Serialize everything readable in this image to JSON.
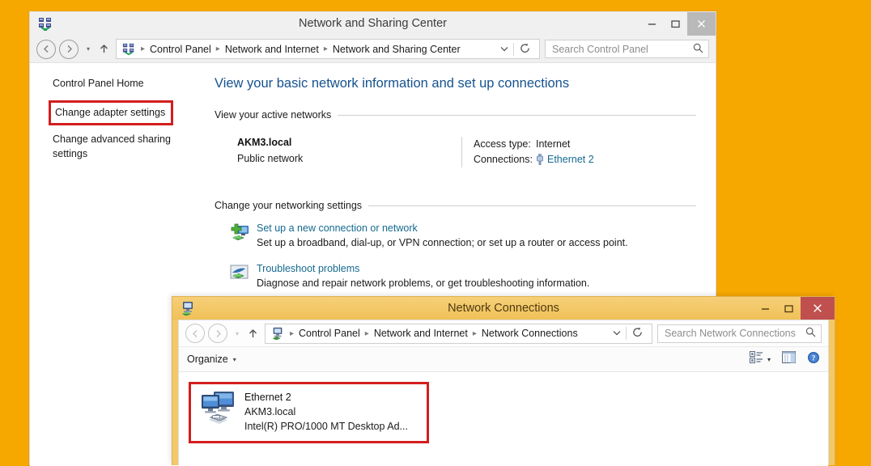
{
  "desktop": {
    "background_color": "#F7A800"
  },
  "window1": {
    "title": "Network and Sharing Center",
    "icon": "network-sharing-icon",
    "buttons": {
      "minimize": "–",
      "maximize": "□",
      "close": "✕"
    },
    "nav": {
      "back": "←",
      "forward": "→",
      "recent": "▾",
      "up": "↑",
      "breadcrumb": [
        "Control Panel",
        "Network and Internet",
        "Network and Sharing Center"
      ],
      "breadcrumb_chevron": "⌄",
      "refresh": "↻",
      "search_placeholder": "Search Control Panel",
      "search_value": ""
    },
    "sidebar": {
      "items": [
        {
          "label": "Control Panel Home",
          "highlighted": false
        },
        {
          "label": "Change adapter settings",
          "highlighted": true
        },
        {
          "label": "Change advanced sharing settings",
          "highlighted": false
        }
      ]
    },
    "main": {
      "heading": "View your basic network information and set up connections",
      "active_networks_header": "View your active networks",
      "active_network": {
        "name": "AKM3.local",
        "type": "Public network",
        "access_type_label": "Access type:",
        "access_type_value": "Internet",
        "connections_label": "Connections:",
        "connections_value": "Ethernet 2"
      },
      "change_settings_header": "Change your networking settings",
      "settings_items": [
        {
          "icon": "new-connection-icon",
          "title": "Set up a new connection or network",
          "description": "Set up a broadband, dial-up, or VPN connection; or set up a router or access point."
        },
        {
          "icon": "troubleshoot-icon",
          "title": "Troubleshoot problems",
          "description": "Diagnose and repair network problems, or get troubleshooting information."
        }
      ]
    }
  },
  "window2": {
    "title": "Network Connections",
    "icon": "network-connections-icon",
    "buttons": {
      "minimize": "–",
      "maximize": "□",
      "close": "✕"
    },
    "nav": {
      "back": "←",
      "forward": "→",
      "recent": "▾",
      "up": "↑",
      "breadcrumb": [
        "Control Panel",
        "Network and Internet",
        "Network Connections"
      ],
      "breadcrumb_chevron": "⌄",
      "refresh": "↻",
      "search_placeholder": "Search Network Connections",
      "search_value": ""
    },
    "toolbar": {
      "organize_label": "Organize",
      "organize_caret": "▾",
      "view_icon": "view-options-icon",
      "view_caret": "▾",
      "preview_pane_icon": "preview-pane-icon",
      "help_icon": "help-icon"
    },
    "connections": [
      {
        "icon": "ethernet-adapter-icon",
        "name": "Ethernet 2",
        "network": "AKM3.local",
        "adapter": "Intel(R) PRO/1000 MT Desktop Ad...",
        "highlighted": true
      }
    ]
  },
  "colors": {
    "highlight_red": "#d31e1e",
    "link_blue": "#156a8f",
    "heading_blue": "#15528f",
    "active_titlebar": "#f2c96a",
    "close_red": "#c0504d"
  }
}
